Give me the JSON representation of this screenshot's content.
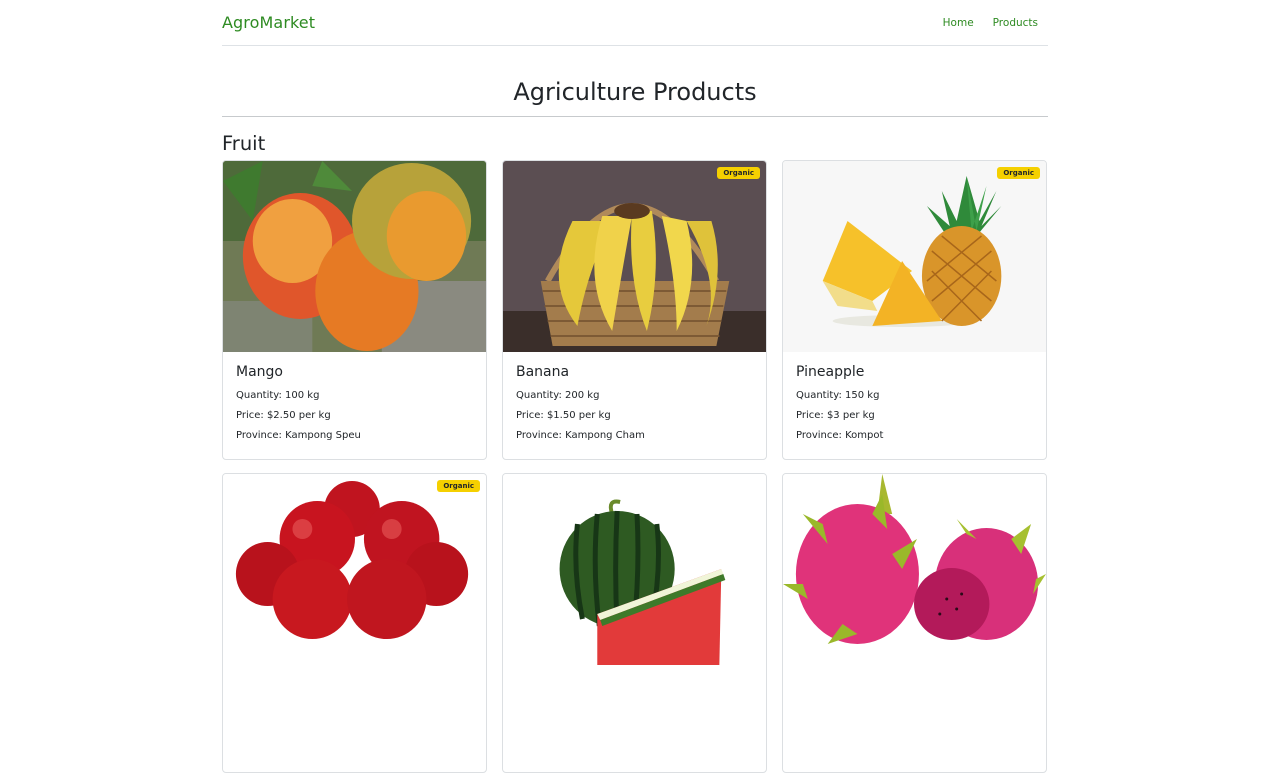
{
  "nav": {
    "brand": "AgroMarket",
    "links": [
      "Home",
      "Products"
    ]
  },
  "page": {
    "title": "Agriculture Products",
    "section": "Fruit"
  },
  "colors": {
    "brand": "#2e8b22",
    "badge": "#f5d000"
  },
  "products": [
    {
      "name": "Mango",
      "badge": "",
      "quantity": "Quantity: 100 kg",
      "price": "Price: $2.50 per kg",
      "province": "Province: Kampong Speu"
    },
    {
      "name": "Banana",
      "badge": "Organic",
      "quantity": "Quantity: 200 kg",
      "price": "Price: $1.50 per kg",
      "province": "Province: Kampong Cham"
    },
    {
      "name": "Pineapple",
      "badge": "Organic",
      "quantity": "Quantity: 150 kg",
      "price": "Price: $3 per kg",
      "province": "Province: Kompot"
    },
    {
      "name": "",
      "badge": "Organic",
      "quantity": "",
      "price": "",
      "province": ""
    },
    {
      "name": "",
      "badge": "",
      "quantity": "",
      "price": "",
      "province": ""
    },
    {
      "name": "",
      "badge": "",
      "quantity": "",
      "price": "",
      "province": ""
    }
  ]
}
